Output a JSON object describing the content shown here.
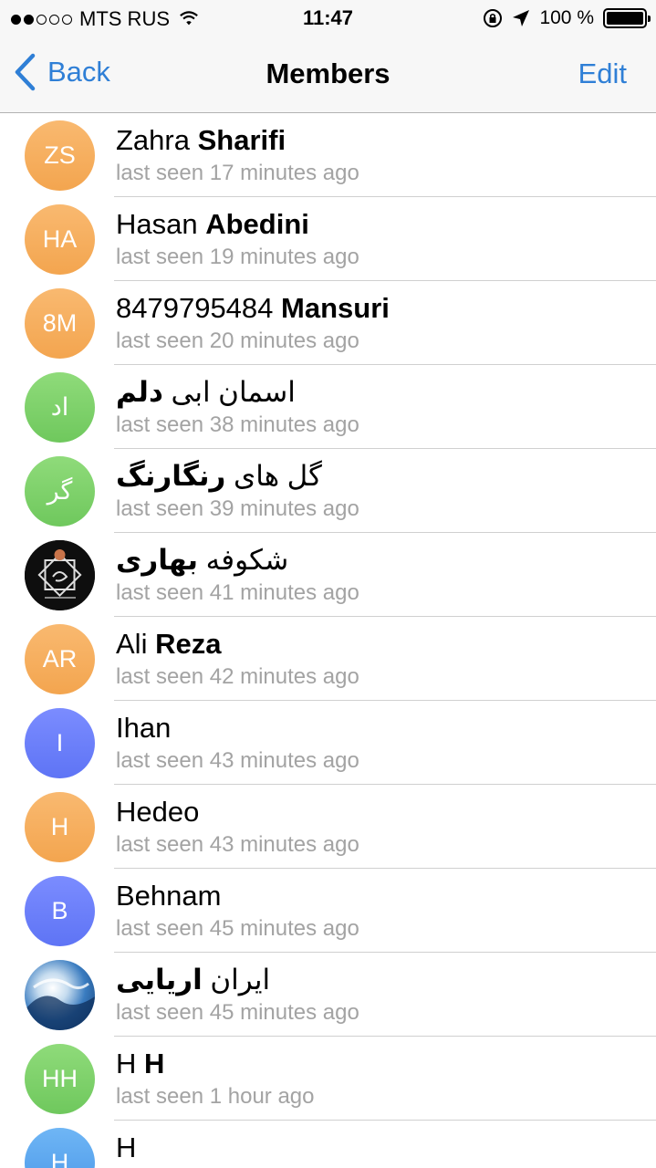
{
  "status_bar": {
    "carrier": "MTS RUS",
    "time": "11:47",
    "battery": "100 %",
    "icons": [
      "signal-dots-icon",
      "wifi-icon",
      "rotation-lock-icon",
      "location-arrow-icon",
      "battery-icon"
    ]
  },
  "nav": {
    "back_label": "Back",
    "title": "Members",
    "edit_label": "Edit"
  },
  "colors": {
    "accent": "#2f7fd6",
    "orange": "#f3a54f",
    "green": "#6fc85d",
    "blue": "#5e74f5",
    "status_gray": "#a3a3a3"
  },
  "members": [
    {
      "initials": "ZS",
      "first": "Zahra",
      "last": "Sharifi",
      "status": "last seen 17 minutes ago",
      "avatar": "orange"
    },
    {
      "initials": "HA",
      "first": "Hasan",
      "last": "Abedini",
      "status": "last seen 19 minutes ago",
      "avatar": "orange"
    },
    {
      "initials": "8M",
      "first": "8479795484",
      "last": "Mansuri",
      "status": "last seen 20 minutes ago",
      "avatar": "orange"
    },
    {
      "initials": "اد",
      "first": "اسمان ابی",
      "last": "دلم",
      "status": "last seen 38 minutes ago",
      "avatar": "green"
    },
    {
      "initials": "گر",
      "first": "گل های",
      "last": "رنگارنگ",
      "status": "last seen 39 minutes ago",
      "avatar": "green"
    },
    {
      "initials": "",
      "first": "شکوفه",
      "last": "بهاری",
      "status": "last seen 41 minutes ago",
      "avatar": "dark"
    },
    {
      "initials": "AR",
      "first": "Ali",
      "last": "Reza",
      "status": "last seen 42 minutes ago",
      "avatar": "orange"
    },
    {
      "initials": "I",
      "first": "Ihan",
      "last": "",
      "status": "last seen 43 minutes ago",
      "avatar": "blue"
    },
    {
      "initials": "H",
      "first": "Hedeo",
      "last": "",
      "status": "last seen 43 minutes ago",
      "avatar": "orange"
    },
    {
      "initials": "B",
      "first": "Behnam",
      "last": "",
      "status": "last seen 45 minutes ago",
      "avatar": "blue"
    },
    {
      "initials": "",
      "first": "ایران",
      "last": "اریایی",
      "status": "last seen 45 minutes ago",
      "avatar": "sky"
    },
    {
      "initials": "HH",
      "first": "H",
      "last": "H",
      "status": "last seen 1 hour ago",
      "avatar": "green"
    },
    {
      "initials": "H",
      "first": "H",
      "last": "",
      "status": "",
      "avatar": "lightblue"
    }
  ]
}
